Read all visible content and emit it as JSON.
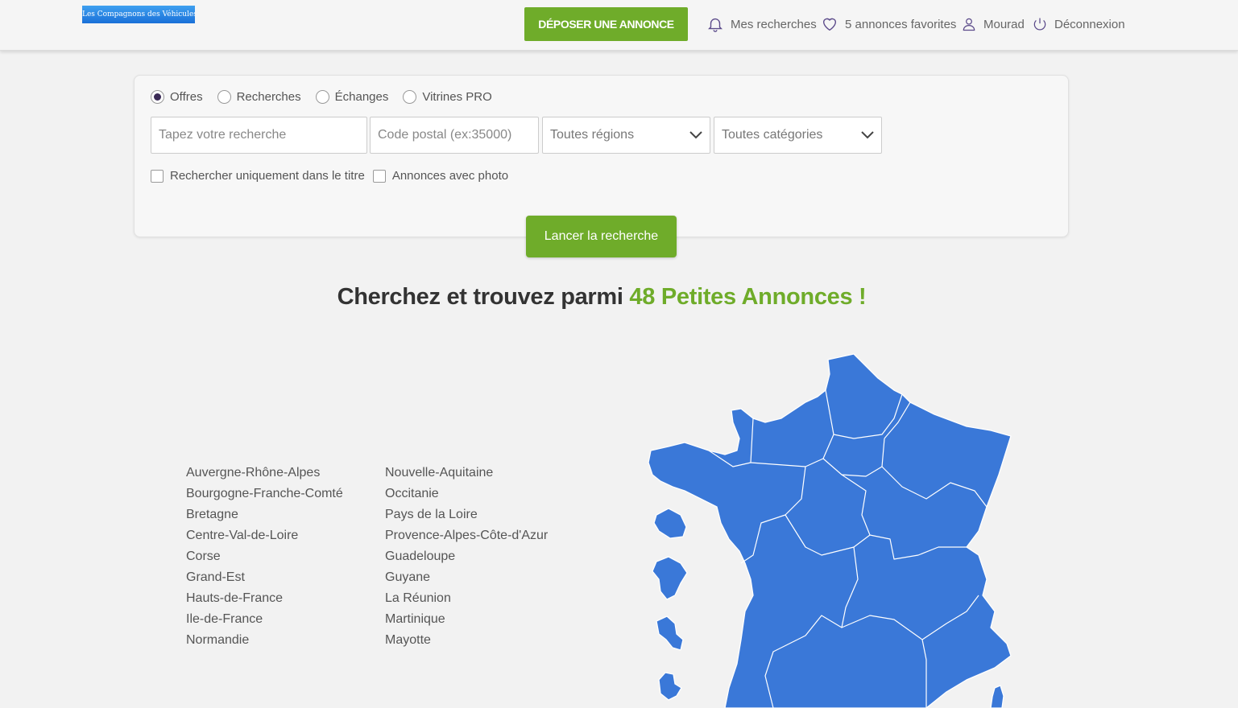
{
  "header": {
    "logo_text": "Les Compagnons des Véhicules",
    "post_button": "DÉPOSER UNE ANNONCE",
    "nav": [
      {
        "label": "Mes recherches",
        "icon": "bell-icon"
      },
      {
        "label": "5 annonces favorites",
        "icon": "heart-icon"
      },
      {
        "label": "Mourad",
        "icon": "user-icon"
      },
      {
        "label": "Déconnexion",
        "icon": "power-icon"
      }
    ]
  },
  "search": {
    "types": [
      {
        "label": "Offres",
        "selected": true
      },
      {
        "label": "Recherches",
        "selected": false
      },
      {
        "label": "Échanges",
        "selected": false
      },
      {
        "label": "Vitrines PRO",
        "selected": false
      }
    ],
    "query_placeholder": "Tapez votre recherche",
    "postal_placeholder": "Code postal (ex:35000)",
    "region_select": "Toutes régions",
    "category_select": "Toutes catégories",
    "checkbox_title": "Rechercher uniquement dans le titre",
    "checkbox_photo": "Annonces avec photo",
    "submit": "Lancer la recherche"
  },
  "headline": {
    "prefix": "Cherchez et trouvez parmi ",
    "accent": "48 Petites Annonces !"
  },
  "regions": {
    "column1": [
      "Auvergne-Rhône-Alpes",
      "Bourgogne-Franche-Comté",
      "Bretagne",
      "Centre-Val-de-Loire",
      "Corse",
      "Grand-Est",
      "Hauts-de-France",
      "Ile-de-France",
      "Normandie"
    ],
    "column2": [
      "Nouvelle-Aquitaine",
      "Occitanie",
      "Pays de la Loire",
      "Provence-Alpes-Côte-d'Azur",
      "Guadeloupe",
      "Guyane",
      "La Réunion",
      "Martinique",
      "Mayotte"
    ]
  },
  "colors": {
    "accent_green": "#6fac2a",
    "map_blue": "#3a78d8",
    "icon_purple": "#5b4a8a"
  }
}
